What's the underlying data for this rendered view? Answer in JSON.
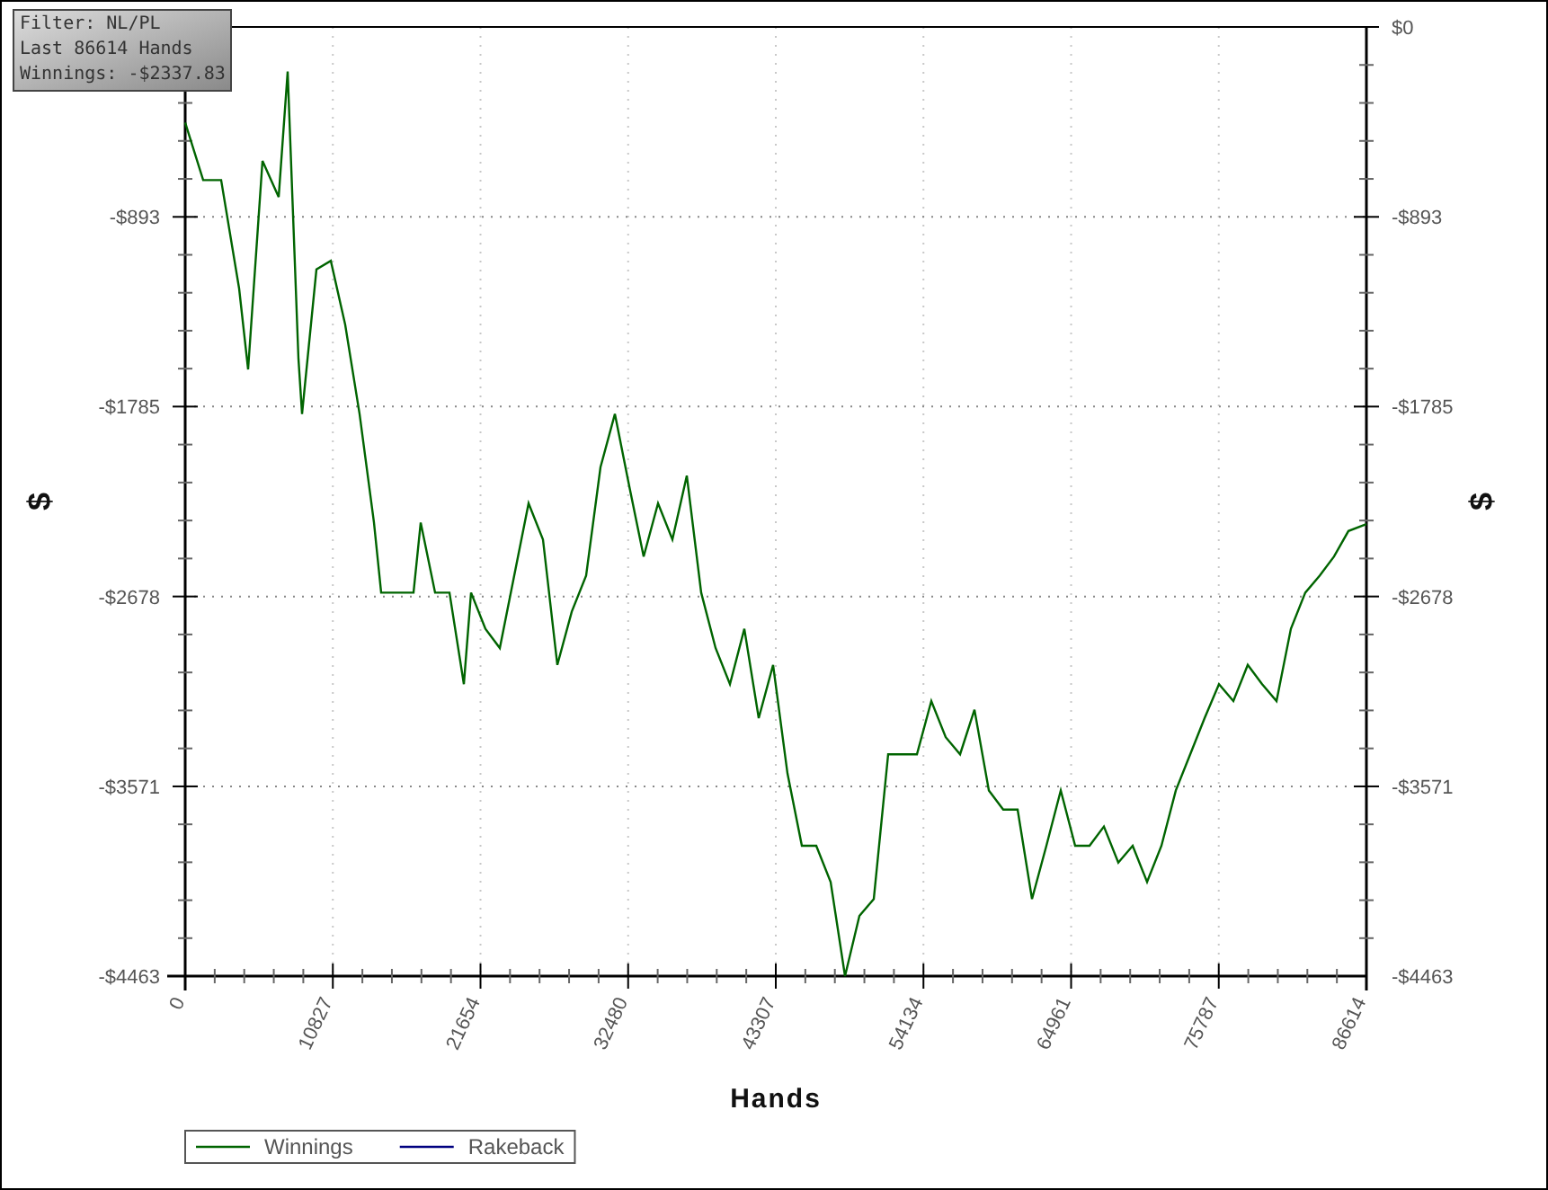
{
  "info_box": {
    "lines": [
      "Filter: NL/PL",
      "Last 86614 Hands",
      "Winnings: -$2337.83"
    ]
  },
  "chart": {
    "chart_data": {
      "type": "line",
      "grid": true,
      "xlabel": "Hands",
      "ylabel": "$",
      "xlim": [
        0,
        86614
      ],
      "ylim": [
        -4463,
        0
      ],
      "xticks": [
        0,
        10827,
        21654,
        32480,
        43307,
        54134,
        64961,
        75787,
        86614
      ],
      "yticks": [
        {
          "value": 0,
          "label": "$0"
        },
        {
          "value": -893,
          "label": "-$893"
        },
        {
          "value": -1785,
          "label": "-$1785"
        },
        {
          "value": -2678,
          "label": "-$2678"
        },
        {
          "value": -3571,
          "label": "-$3571"
        },
        {
          "value": -4463,
          "label": "-$4463"
        }
      ],
      "x": [
        0,
        1318,
        2637,
        3955,
        4614,
        5669,
        6855,
        7514,
        8305,
        8569,
        9624,
        10678,
        11733,
        12788,
        13843,
        14370,
        15424,
        16743,
        17270,
        18325,
        19379,
        20434,
        20961,
        22016,
        23071,
        24125,
        25180,
        26235,
        27289,
        28344,
        29398,
        30453,
        31508,
        32562,
        33617,
        34672,
        35726,
        36781,
        37835,
        38890,
        39945,
        40999,
        42054,
        43108,
        44163,
        45218,
        46272,
        47327,
        48382,
        49436,
        50491,
        51545,
        52600,
        53655,
        54709,
        55764,
        56819,
        57873,
        58928,
        59982,
        61037,
        62092,
        63146,
        64201,
        65255,
        66310,
        67365,
        68419,
        69474,
        70529,
        71583,
        72638,
        73692,
        74747,
        75802,
        76856,
        77911,
        78965,
        80020,
        81075,
        82129,
        83184,
        84239,
        85293,
        86614
      ],
      "series": [
        {
          "name": "Winnings",
          "color": "#006400",
          "values": [
            -450,
            -720,
            -720,
            -1230,
            -1610,
            -630,
            -800,
            -210,
            -1560,
            -1820,
            -1140,
            -1100,
            -1400,
            -1820,
            -2330,
            -2660,
            -2660,
            -2660,
            -2330,
            -2660,
            -2660,
            -3090,
            -2660,
            -2830,
            -2920,
            -2580,
            -2240,
            -2410,
            -3000,
            -2750,
            -2580,
            -2070,
            -1820,
            -2160,
            -2490,
            -2240,
            -2410,
            -2110,
            -2660,
            -2920,
            -3090,
            -2830,
            -3250,
            -3000,
            -3510,
            -3850,
            -3850,
            -4020,
            -4463,
            -4180,
            -4100,
            -3420,
            -3420,
            -3420,
            -3170,
            -3340,
            -3420,
            -3210,
            -3590,
            -3680,
            -3680,
            -4100,
            -3850,
            -3590,
            -3850,
            -3850,
            -3760,
            -3930,
            -3850,
            -4020,
            -3850,
            -3590,
            -3420,
            -3250,
            -3090,
            -3170,
            -3000,
            -3090,
            -3170,
            -2830,
            -2660,
            -2580,
            -2490,
            -2370,
            -2338
          ]
        },
        {
          "name": "Rakeback",
          "color": "#000080",
          "values": [
            null,
            null,
            null,
            null,
            null,
            null,
            null,
            null,
            null,
            null,
            null,
            null,
            null,
            null,
            null,
            null,
            null,
            null,
            null,
            null,
            null,
            null,
            null,
            null,
            null,
            null,
            null,
            null,
            null,
            null,
            null,
            null,
            null,
            null,
            null,
            null,
            null,
            null,
            null,
            null,
            null,
            null,
            null,
            null,
            null,
            null,
            null,
            null,
            null,
            null,
            null,
            null,
            null,
            null,
            null,
            null,
            null,
            null,
            null,
            null,
            null,
            null,
            null,
            null,
            null,
            null,
            null,
            null,
            null,
            null,
            null,
            null,
            null,
            null,
            null,
            null,
            null,
            null,
            null,
            null,
            null,
            null,
            null,
            null,
            null
          ]
        }
      ]
    }
  }
}
